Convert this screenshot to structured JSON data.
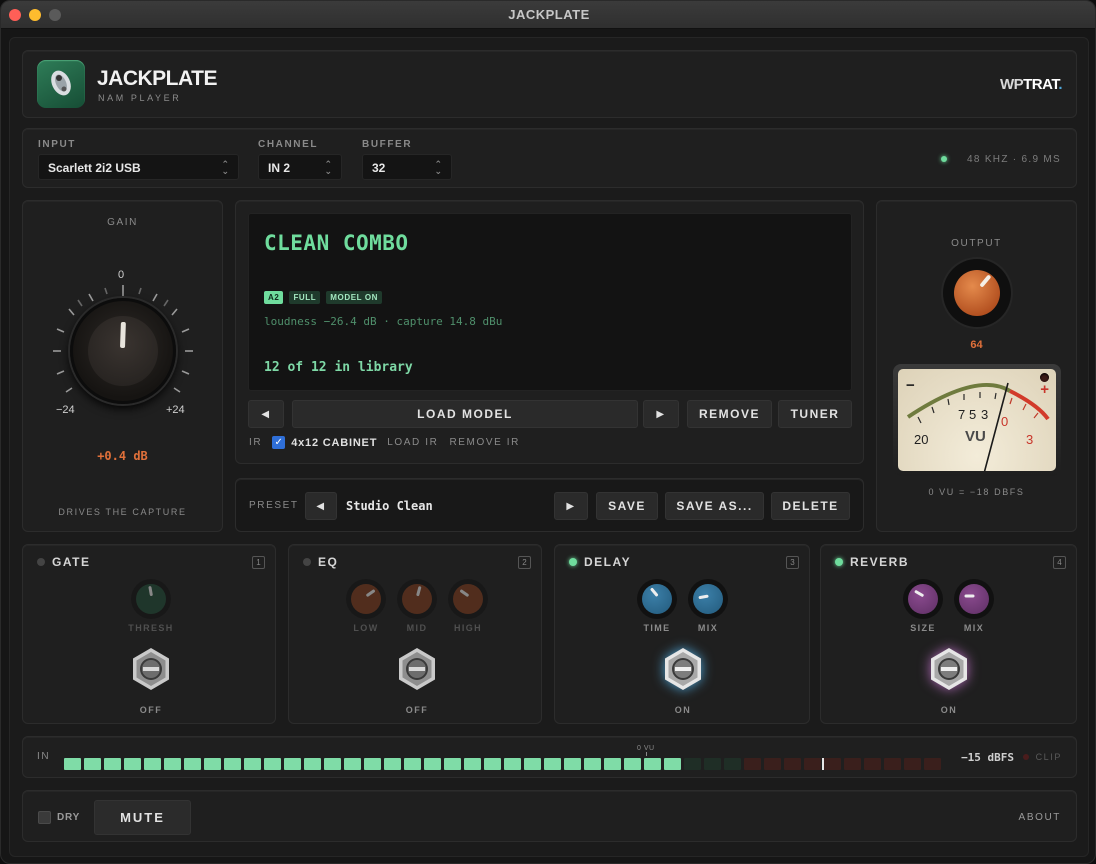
{
  "window": {
    "title": "JACKPLATE"
  },
  "header": {
    "app_name": "JACKPLATE",
    "subtitle": "NAM PLAYER",
    "brand_a": "WP",
    "brand_b": "TRAT",
    "brand_dot": "."
  },
  "io": {
    "input_label": "INPUT",
    "input_value": "Scarlett 2i2 USB",
    "channel_label": "CHANNEL",
    "channel_value": "IN 2",
    "buffer_label": "BUFFER",
    "buffer_value": "32",
    "status": "48 KHZ · 6.9 MS"
  },
  "gain": {
    "label": "GAIN",
    "tick_top": "0",
    "tick_min": "−24",
    "tick_max": "+24",
    "value": "+0.4 dB",
    "footer": "DRIVES THE CAPTURE"
  },
  "display": {
    "model_name": "CLEAN COMBO",
    "tags": [
      "A2",
      "FULL",
      "MODEL ON"
    ],
    "info": "loudness −26.4 dB · capture 14.8 dBu",
    "library": "12 of 12 in library"
  },
  "model_controls": {
    "prev": "◀",
    "load": "LOAD MODEL",
    "next": "▶",
    "remove": "REMOVE",
    "tuner": "TUNER"
  },
  "ir": {
    "label": "IR",
    "checkbox_label": "4x12 CABINET",
    "checked": true,
    "load": "LOAD IR",
    "remove": "REMOVE IR"
  },
  "preset": {
    "label": "PRESET",
    "prev": "◀",
    "name": "Studio Clean",
    "next": "▶",
    "save": "SAVE",
    "save_as": "SAVE AS...",
    "delete": "DELETE"
  },
  "output": {
    "label": "OUTPUT",
    "value": "64",
    "vu_minus": "−",
    "vu_plus": "+",
    "vu_scale": [
      "20",
      "7",
      "5",
      "3",
      "0",
      "3"
    ],
    "vu_label": "VU",
    "note": "0 VU = −18 DBFS"
  },
  "fx": [
    {
      "name": "GATE",
      "num": "1",
      "on": false,
      "knobs": [
        "THRESH"
      ],
      "state": "OFF"
    },
    {
      "name": "EQ",
      "num": "2",
      "on": false,
      "knobs": [
        "LOW",
        "MID",
        "HIGH"
      ],
      "state": "OFF"
    },
    {
      "name": "DELAY",
      "num": "3",
      "on": true,
      "knobs": [
        "TIME",
        "MIX"
      ],
      "state": "ON"
    },
    {
      "name": "REVERB",
      "num": "4",
      "on": true,
      "knobs": [
        "SIZE",
        "MIX"
      ],
      "state": "ON"
    }
  ],
  "meter": {
    "label": "IN",
    "marker": "0 VU",
    "readout": "−15 dBFS",
    "clip": "CLIP",
    "level": 0.7
  },
  "footer": {
    "dry": "DRY",
    "mute": "MUTE",
    "about": "ABOUT"
  },
  "colors": {
    "accent": "#6fdc9d",
    "orange": "#e0703a",
    "bg": "#1b1b1b"
  }
}
